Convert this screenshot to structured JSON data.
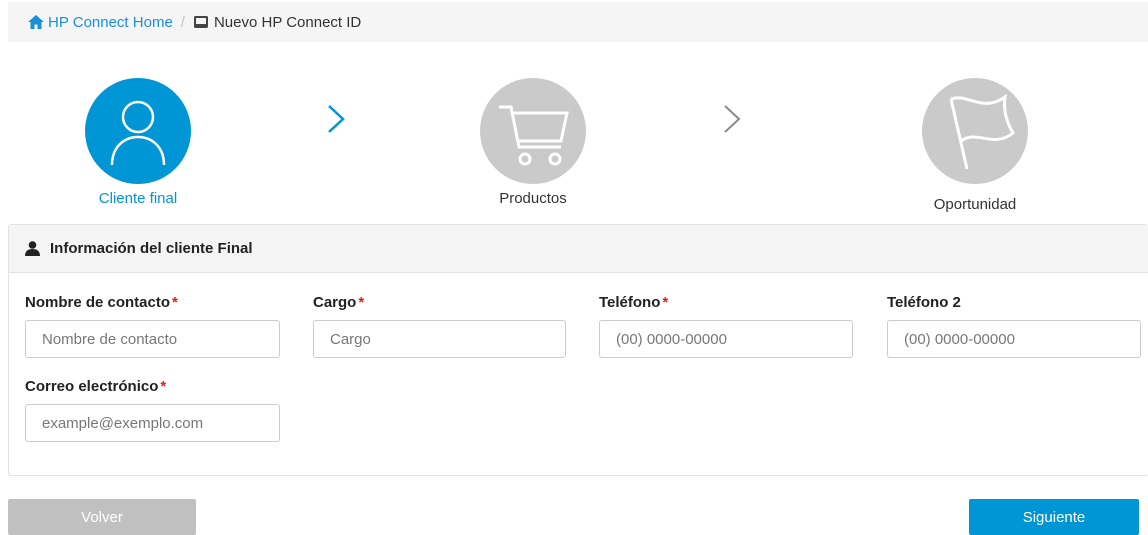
{
  "breadcrumb": {
    "home_label": "HP Connect Home",
    "separator": "/",
    "current_label": "Nuevo HP Connect ID"
  },
  "steps": [
    {
      "label": "Cliente final",
      "state": "active",
      "icon": "user-icon"
    },
    {
      "label": "Productos",
      "state": "inactive",
      "icon": "cart-icon"
    },
    {
      "label": "Oportunidad",
      "state": "inactive",
      "icon": "flag-icon"
    }
  ],
  "colors": {
    "accent": "#0096d6",
    "inactive": "#cacaca",
    "required": "#e02020",
    "link": "#1b8fd9"
  },
  "panel": {
    "title": "Información del cliente Final",
    "fields": [
      {
        "label": "Nombre de contacto",
        "required": "*",
        "placeholder": "Nombre de contacto",
        "value": ""
      },
      {
        "label": "Cargo",
        "required": "*",
        "placeholder": "Cargo",
        "value": ""
      },
      {
        "label": "Teléfono",
        "required": "*",
        "placeholder": "(00) 0000-00000",
        "value": ""
      },
      {
        "label": "Teléfono 2",
        "required": "",
        "placeholder": "(00) 0000-00000",
        "value": ""
      },
      {
        "label": "Correo electrónico",
        "required": "*",
        "placeholder": "example@exemplo.com",
        "value": ""
      }
    ]
  },
  "buttons": {
    "back_label": "Volver",
    "next_label": "Siguiente"
  }
}
